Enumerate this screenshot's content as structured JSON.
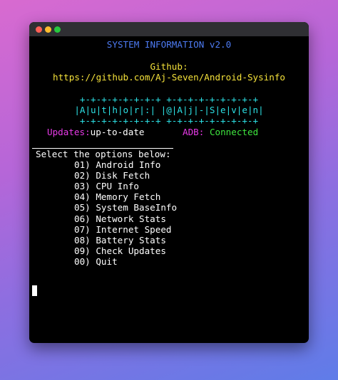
{
  "terminal": {
    "title": "SYSTEM INFORMATION v2.0",
    "github_label": "Github:",
    "github_url": "https://github.com/Aj-Seven/Android-Sysinfo",
    "border_top": "+-+-+-+-+-+-+-+ +-+-+-+-+-+-+-+-+",
    "author_line": "|A|u|t|h|o|r|:| |@|A|j|-|S|e|v|e|n|",
    "border_bottom": "+-+-+-+-+-+-+-+ +-+-+-+-+-+-+-+-+",
    "updates_label": "Updates:",
    "updates_value": "up-to-date",
    "adb_label": "ADB:",
    "adb_value": "Connected",
    "prompt": "Select the options below:",
    "options": [
      "01) Android Info",
      "02) Disk Fetch",
      "03) CPU Info",
      "04) Memory Fetch",
      "05) System BaseInfo",
      "06) Network Stats",
      "07) Internet Speed",
      "08) Battery Stats",
      "09) Check Updates",
      "00) Quit"
    ]
  },
  "colors": {
    "title": "#4d7bf3",
    "github": "#f4e13a",
    "banner": "#2ce0e4",
    "labels": "#e83ae8",
    "connected": "#3ee63e"
  }
}
